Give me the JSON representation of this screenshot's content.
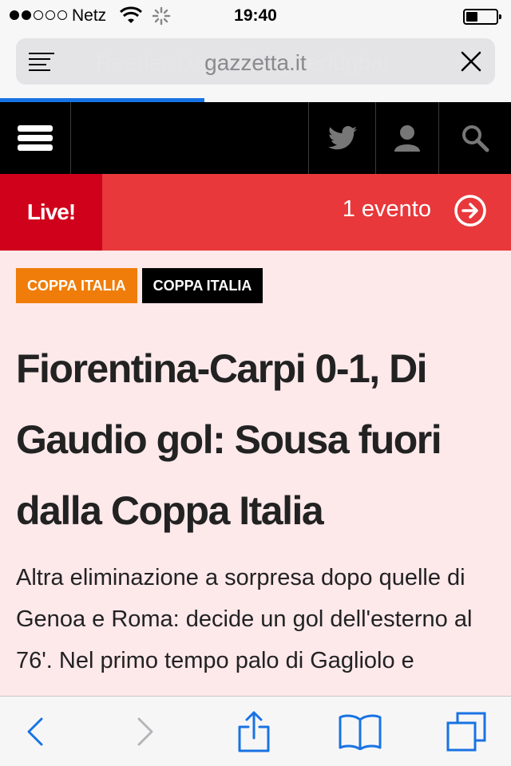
{
  "status_bar": {
    "carrier": "Netz",
    "time": "19:40",
    "signal_bars": 2,
    "battery_level": 0.4
  },
  "safari": {
    "reader_banner": "Reader-Darstellung verfügbar",
    "url": "gazzetta.it",
    "load_progress": 0.4
  },
  "site_nav": {
    "icons": [
      "menu-icon",
      "twitter-icon",
      "user-icon",
      "search-icon"
    ]
  },
  "live_banner": {
    "label": "Live!",
    "event_count": "1 evento"
  },
  "article": {
    "tags": [
      "COPPA ITALIA",
      "COPPA ITALIA"
    ],
    "headline": "Fiorentina-Carpi 0-1, Di Gaudio gol: Sousa fuori dalla Coppa Italia",
    "summary": "Altra eliminazione a sorpresa dopo quelle di Genoa e Roma: decide un gol dell'esterno al 76'. Nel primo tempo palo di Gagliolo e"
  },
  "toolbar": {
    "icons": [
      "back-icon",
      "forward-icon",
      "share-icon",
      "bookmarks-icon",
      "tabs-icon"
    ]
  },
  "colors": {
    "live_red": "#e8383b",
    "live_label_red": "#d0021b",
    "tag_orange": "#f07d0a",
    "page_bg": "#fde8ea",
    "progress_blue": "#1873e3"
  }
}
